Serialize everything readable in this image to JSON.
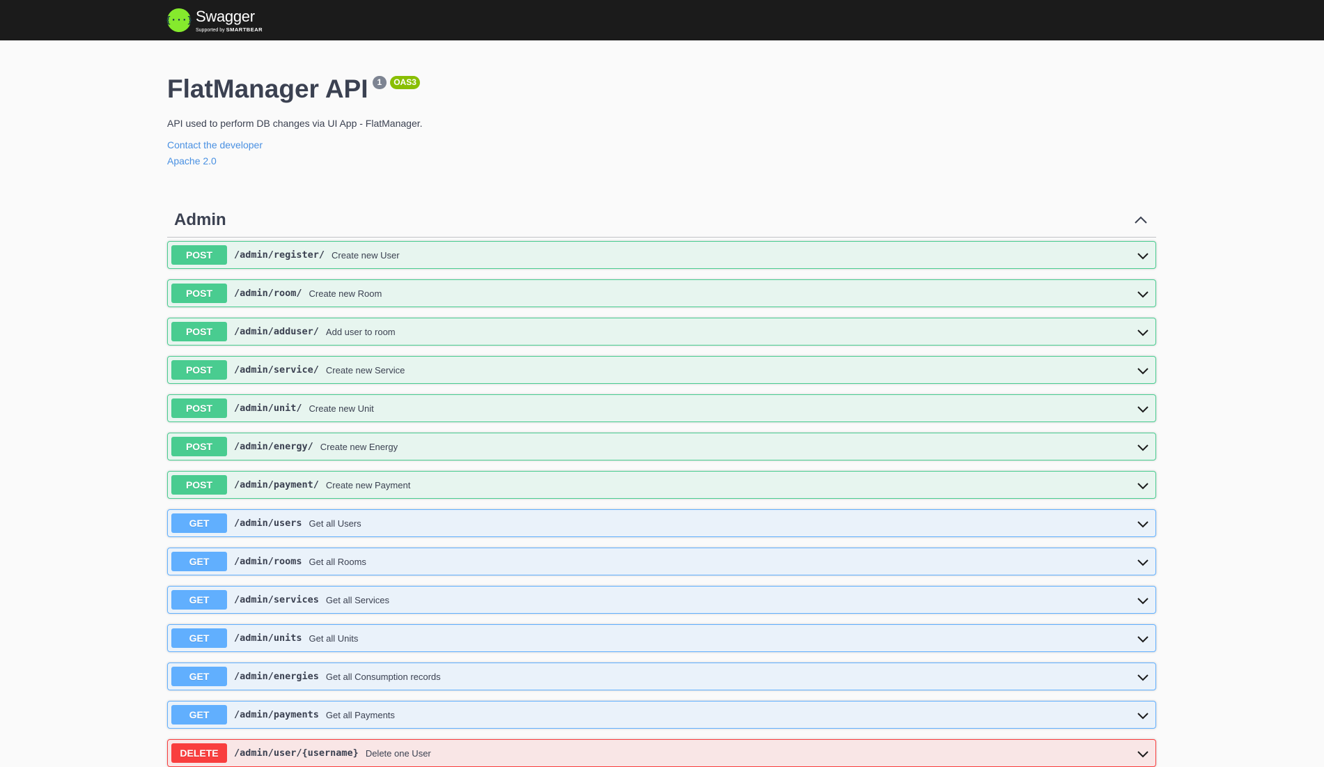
{
  "topbar": {
    "logo_mark": "{···}",
    "brand_name": "Swagger",
    "brand_sub_prefix": "Supported by",
    "brand_sub_company": "SMARTBEAR"
  },
  "info": {
    "title": "FlatManager API",
    "version_badge": "1",
    "oas_badge": "OAS3",
    "description": "API used to perform DB changes via UI App - FlatManager.",
    "contact_link": "Contact the developer",
    "license_link": "Apache 2.0"
  },
  "tag": {
    "name": "Admin",
    "toggle_icon": "chevron-up-icon"
  },
  "colors": {
    "post": "#49cc90",
    "get": "#61affe",
    "delete": "#f93e3e",
    "topbar": "#1b1b1b",
    "logo_green": "#85ea2d"
  },
  "operations": [
    {
      "method": "POST",
      "path": "/admin/register/",
      "summary": "Create new User"
    },
    {
      "method": "POST",
      "path": "/admin/room/",
      "summary": "Create new Room"
    },
    {
      "method": "POST",
      "path": "/admin/adduser/",
      "summary": "Add user to room"
    },
    {
      "method": "POST",
      "path": "/admin/service/",
      "summary": "Create new Service"
    },
    {
      "method": "POST",
      "path": "/admin/unit/",
      "summary": "Create new Unit"
    },
    {
      "method": "POST",
      "path": "/admin/energy/",
      "summary": "Create new Energy"
    },
    {
      "method": "POST",
      "path": "/admin/payment/",
      "summary": "Create new Payment"
    },
    {
      "method": "GET",
      "path": "/admin/users",
      "summary": "Get all Users"
    },
    {
      "method": "GET",
      "path": "/admin/rooms",
      "summary": "Get all Rooms"
    },
    {
      "method": "GET",
      "path": "/admin/services",
      "summary": "Get all Services"
    },
    {
      "method": "GET",
      "path": "/admin/units",
      "summary": "Get all Units"
    },
    {
      "method": "GET",
      "path": "/admin/energies",
      "summary": "Get all Consumption records"
    },
    {
      "method": "GET",
      "path": "/admin/payments",
      "summary": "Get all Payments"
    },
    {
      "method": "DELETE",
      "path": "/admin/user/{username}",
      "summary": "Delete one User"
    }
  ]
}
